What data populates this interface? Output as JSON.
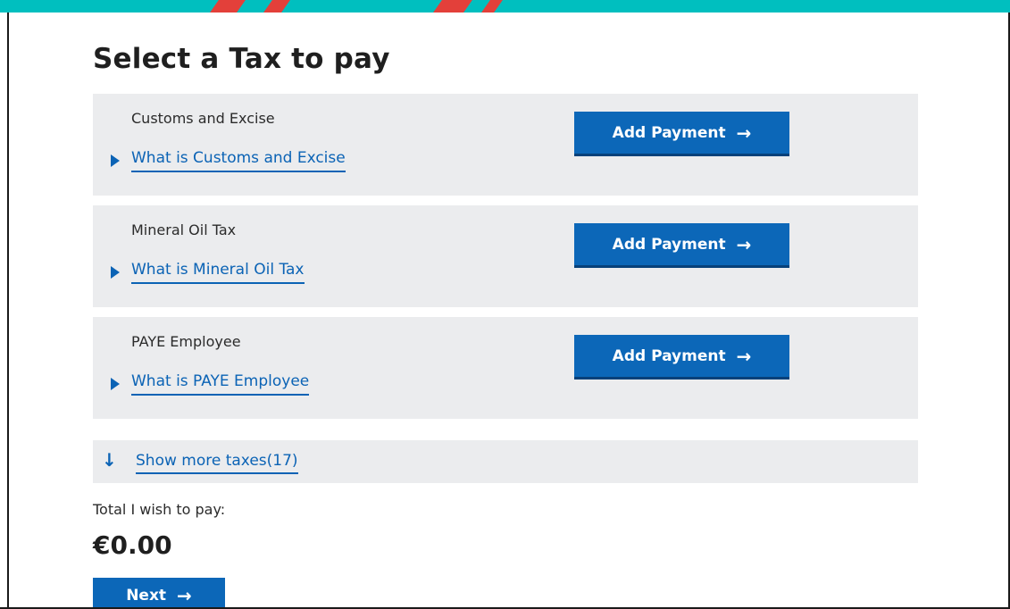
{
  "page": {
    "title": "Select a Tax to pay"
  },
  "taxes": [
    {
      "name": "Customs and Excise",
      "link": "What is Customs and Excise",
      "button": "Add Payment"
    },
    {
      "name": "Mineral Oil Tax",
      "link": "What is Mineral Oil Tax",
      "button": "Add Payment"
    },
    {
      "name": "PAYE Employee",
      "link": "What is PAYE Employee",
      "button": "Add Payment"
    }
  ],
  "show_more": {
    "label": "Show more taxes(17)",
    "icon": "arrow-down-icon"
  },
  "total": {
    "label": "Total I wish to pay:",
    "amount": "€0.00"
  },
  "next": {
    "label": "Next"
  },
  "icons": {
    "arrow_right": "→",
    "arrow_down": "🡇"
  },
  "colors": {
    "accent_bar": "#00bfbf",
    "primary_button": "#0c67b8",
    "link": "#0b63b5",
    "card_bg": "#ebecee"
  }
}
